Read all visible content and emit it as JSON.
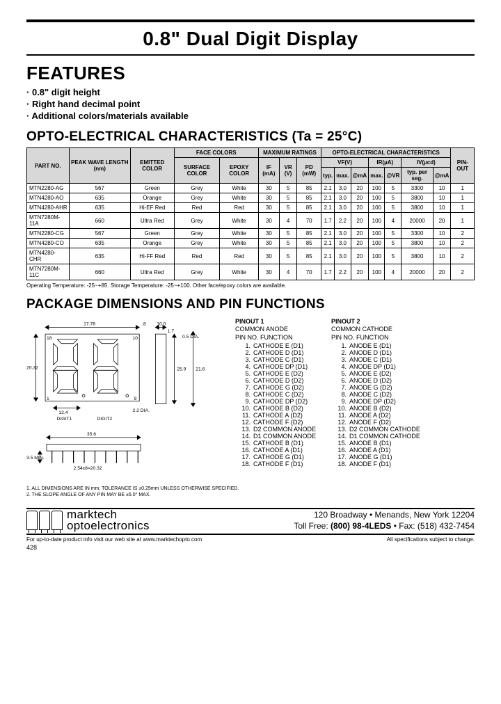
{
  "title": "0.8\" Dual Digit Display",
  "sections": {
    "features_h": "FEATURES",
    "opto_h": "OPTO-ELECTRICAL CHARACTERISTICS (Ta = 25°C)",
    "pkg_h": "PACKAGE DIMENSIONS AND PIN FUNCTIONS"
  },
  "features": [
    "0.8\" digit height",
    "Right hand decimal point",
    "Additional colors/materials available"
  ],
  "opto_header": {
    "part": "PART NO.",
    "peak": "PEAK WAVE LENGTH (nm)",
    "color": "EMITTED COLOR",
    "face": "FACE COLORS",
    "surface": "SURFACE COLOR",
    "epoxy": "EPOXY COLOR",
    "max": "MAXIMUM RATINGS",
    "if": "IF (mA)",
    "vr": "VR (V)",
    "pd": "PD (mW)",
    "oec": "OPTO-ELECTRICAL CHARACTERISTICS",
    "vf": "VF(V)",
    "typ": "typ.",
    "max2": "max.",
    "atma": "@mA",
    "ir": "IR(µA)",
    "atvr": "@VR",
    "iv": "IV(µcd)",
    "typseg": "typ. per seg.",
    "pinout": "PIN-OUT"
  },
  "opto_rows": [
    {
      "part": "MTN2280-AG",
      "nm": "567",
      "color": "Green",
      "surf": "Grey",
      "epoxy": "White",
      "if": "30",
      "vr": "5",
      "pd": "85",
      "vftyp": "2.1",
      "vfmax": "3.0",
      "vfma": "20",
      "irmax": "100",
      "irvr": "5",
      "ivtyp": "3300",
      "ivma": "10",
      "pin": "1"
    },
    {
      "part": "MTN4280-AO",
      "nm": "635",
      "color": "Orange",
      "surf": "Grey",
      "epoxy": "White",
      "if": "30",
      "vr": "5",
      "pd": "85",
      "vftyp": "2.1",
      "vfmax": "3.0",
      "vfma": "20",
      "irmax": "100",
      "irvr": "5",
      "ivtyp": "3800",
      "ivma": "10",
      "pin": "1"
    },
    {
      "part": "MTN4280-AHR",
      "nm": "635",
      "color": "Hi-EF Red",
      "surf": "Red",
      "epoxy": "Red",
      "if": "30",
      "vr": "5",
      "pd": "85",
      "vftyp": "2.1",
      "vfmax": "3.0",
      "vfma": "20",
      "irmax": "100",
      "irvr": "5",
      "ivtyp": "3800",
      "ivma": "10",
      "pin": "1"
    },
    {
      "part": "MTN7280M-11A",
      "nm": "660",
      "color": "Ultra Red",
      "surf": "Grey",
      "epoxy": "White",
      "if": "30",
      "vr": "4",
      "pd": "70",
      "vftyp": "1.7",
      "vfmax": "2.2",
      "vfma": "20",
      "irmax": "100",
      "irvr": "4",
      "ivtyp": "20000",
      "ivma": "20",
      "pin": "1"
    },
    {
      "part": "MTN2280-CG",
      "nm": "567",
      "color": "Green",
      "surf": "Grey",
      "epoxy": "White",
      "if": "30",
      "vr": "5",
      "pd": "85",
      "vftyp": "2.1",
      "vfmax": "3.0",
      "vfma": "20",
      "irmax": "100",
      "irvr": "5",
      "ivtyp": "3300",
      "ivma": "10",
      "pin": "2"
    },
    {
      "part": "MTN4280-CO",
      "nm": "635",
      "color": "Orange",
      "surf": "Grey",
      "epoxy": "White",
      "if": "30",
      "vr": "5",
      "pd": "85",
      "vftyp": "2.1",
      "vfmax": "3.0",
      "vfma": "20",
      "irmax": "100",
      "irvr": "5",
      "ivtyp": "3800",
      "ivma": "10",
      "pin": "2"
    },
    {
      "part": "MTN4280-CHR",
      "nm": "635",
      "color": "Hi-FF Red",
      "surf": "Red",
      "epoxy": "Red",
      "if": "30",
      "vr": "5",
      "pd": "85",
      "vftyp": "2.1",
      "vfmax": "3.0",
      "vfma": "20",
      "irmax": "100",
      "irvr": "5",
      "ivtyp": "3800",
      "ivma": "10",
      "pin": "2"
    },
    {
      "part": "MTN7280M-11C",
      "nm": "660",
      "color": "Ultra Red",
      "surf": "Grey",
      "epoxy": "White",
      "if": "30",
      "vr": "4",
      "pd": "70",
      "vftyp": "1.7",
      "vfmax": "2.2",
      "vfma": "20",
      "irmax": "100",
      "irvr": "4",
      "ivtyp": "20000",
      "ivma": "20",
      "pin": "2"
    }
  ],
  "table_note": "Operating Temperature: -25~+85. Storage Temperature: -25~+100. Other face/epoxy colors are available.",
  "pinout1": {
    "title": "PINOUT 1",
    "sub": "COMMON ANODE",
    "hdr": "PIN NO.   FUNCTION",
    "pins": [
      "CATHODE E (D1)",
      "CATHODE D (D1)",
      "CATHODE C (D1)",
      "CATHODE DP (D1)",
      "CATHODE E (D2)",
      "CATHODE D (D2)",
      "CATHODE G (D2)",
      "CATHODE C (D2)",
      "CATHODE DP (D2)",
      "CATHODE B (D2)",
      "CATHODE A (D2)",
      "CATHODE F (D2)",
      "D2 COMMON ANODE",
      "D1 COMMON ANODE",
      "CATHODE B (D1)",
      "CATHODE A (D1)",
      "CATHODE G (D1)",
      "CATHODE F (D1)"
    ]
  },
  "pinout2": {
    "title": "PINOUT 2",
    "sub": "COMMON CATHODE",
    "hdr": "PIN NO.   FUNCTION",
    "pins": [
      "ANODE E (D1)",
      "ANODE D (D1)",
      "ANODE C (D1)",
      "ANODE DP (D1)",
      "ANODE E (D2)",
      "ANODE D (D2)",
      "ANODE G (D2)",
      "ANODE C (D2)",
      "ANODE DP (D2)",
      "ANODE B (D2)",
      "ANODE A (D2)",
      "ANODE F (D2)",
      "D2 COMMON CATHODE",
      "D1 COMMON CATHODE",
      "ANODE B (D1)",
      "ANODE A (D1)",
      "ANODE G (D1)",
      "ANODE F (D1)"
    ]
  },
  "dim_labels": {
    "w": "17.78",
    "wtol": ".8",
    "h": "20.32",
    "side_h": "25.9",
    "side_full": "21.6",
    "side_w": "10.0",
    "top_t": "1.7",
    "corner": "0.5 DIA.",
    "digit_w": "12.4",
    "d1": "DIGIT1",
    "d2": "DIGIT2",
    "dp": "2.2 DIA.",
    "row_w": "35.6",
    "pin_h": "3.5 MIN.",
    "pitch": "2.54x8=20.32",
    "pin_top": "18",
    "pin_bot": "1",
    "pin_r_top": "10",
    "pin_r_bot": "9"
  },
  "notes": [
    "1. ALL DIMENSIONS ARE IN mm, TOLERANCE IS ±0.25mm UNLESS OTHERWISE SPECIFIED.",
    "2. THE SLOPE ANGLE OF ANY PIN MAY BE ±5.0° MAX."
  ],
  "footer": {
    "brand1": "marktech",
    "brand2": "optoelectronics",
    "addr1": "120 Broadway • Menands, New York 12204",
    "addr2_a": "Toll Free: ",
    "addr2_b": "(800) 98-4LEDS",
    "addr2_c": " • Fax: (518) 432-7454",
    "web": "For up-to-date product info visit our web site at www.marktechopto.com",
    "spec": "All specifications subject to change.",
    "page": "428"
  }
}
